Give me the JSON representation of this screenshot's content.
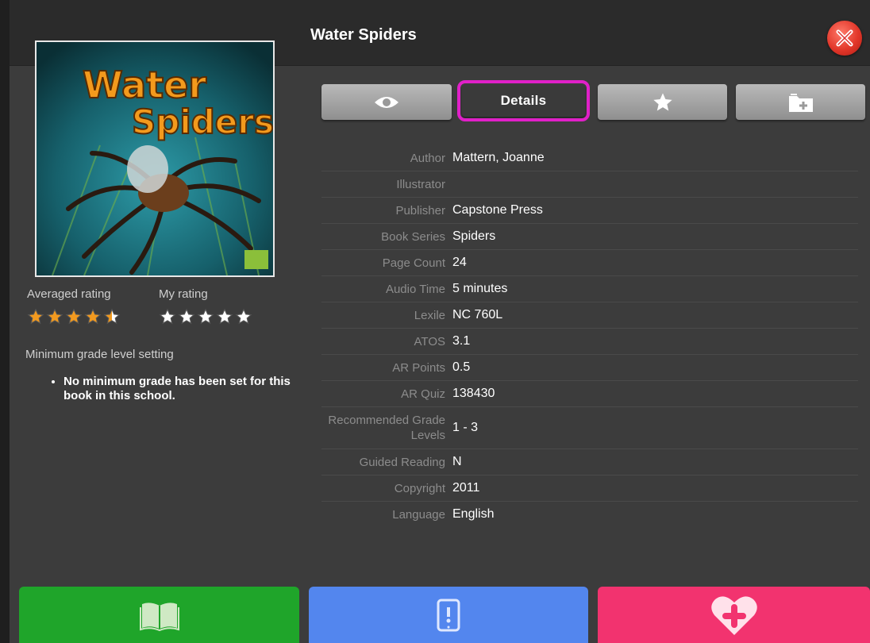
{
  "book": {
    "title": "Water Spiders",
    "cover_title_line1": "Water",
    "cover_title_line2": "Spiders"
  },
  "ratings": {
    "averaged_label": "Averaged rating",
    "averaged_value": 4.5,
    "my_label": "My rating",
    "my_value": 0,
    "max": 5
  },
  "min_grade": {
    "title": "Minimum grade level setting",
    "items": [
      "No minimum grade has been set for this book in this school."
    ]
  },
  "tabs": [
    {
      "id": "preview",
      "icon": "eye-icon",
      "label": ""
    },
    {
      "id": "details",
      "icon": "",
      "label": "Details",
      "active": true
    },
    {
      "id": "favorite",
      "icon": "star-icon",
      "label": ""
    },
    {
      "id": "add-to-folder",
      "icon": "folder-add-icon",
      "label": ""
    }
  ],
  "details": [
    {
      "key": "Author",
      "value": "Mattern, Joanne"
    },
    {
      "key": "Illustrator",
      "value": ""
    },
    {
      "key": "Publisher",
      "value": "Capstone Press"
    },
    {
      "key": "Book Series",
      "value": "Spiders"
    },
    {
      "key": "Page Count",
      "value": "24"
    },
    {
      "key": "Audio Time",
      "value": "5 minutes"
    },
    {
      "key": "Lexile",
      "value": "NC 760L"
    },
    {
      "key": "ATOS",
      "value": "3.1"
    },
    {
      "key": "AR Points",
      "value": "0.5"
    },
    {
      "key": "AR Quiz",
      "value": "138430"
    },
    {
      "key": "Recommended Grade Levels",
      "value": "1 - 3"
    },
    {
      "key": "Guided Reading",
      "value": "N"
    },
    {
      "key": "Copyright",
      "value": "2011"
    },
    {
      "key": "Language",
      "value": "English"
    }
  ],
  "bottom_buttons": [
    {
      "id": "read",
      "icon": "open-book-icon",
      "color": "#1fa52a"
    },
    {
      "id": "device",
      "icon": "tablet-download-icon",
      "color": "#5386ee"
    },
    {
      "id": "favorite-add",
      "icon": "heart-plus-icon",
      "color": "#f2336f"
    }
  ],
  "colors": {
    "star_filled": "#f29a1f",
    "star_empty": "#ffffff",
    "active_tab_outline": "#e020c8",
    "close_button": "#e2372a"
  }
}
